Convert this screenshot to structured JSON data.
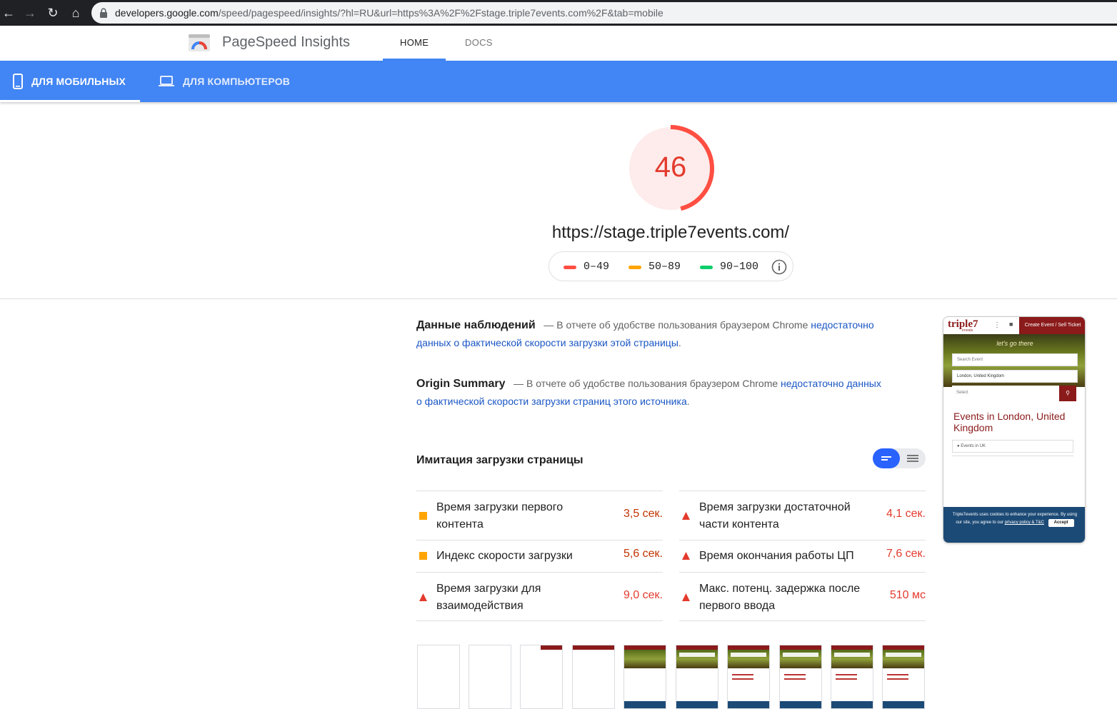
{
  "browser": {
    "url_host": "developers.google.com",
    "url_rest": "/speed/pagespeed/insights/?hl=RU&url=https%3A%2F%2Fstage.triple7events.com%2F&tab=mobile"
  },
  "header": {
    "app_title": "PageSpeed Insights",
    "nav": [
      "HOME",
      "DOCS"
    ]
  },
  "device_tabs": {
    "mobile": "ДЛЯ МОБИЛЬНЫХ",
    "desktop": "ДЛЯ КОМПЬЮТЕРОВ"
  },
  "summary": {
    "score": "46",
    "score_fraction": 0.46,
    "url": "https://stage.triple7events.com/",
    "legend": [
      "0–49",
      "50–89",
      "90–100"
    ]
  },
  "colors": {
    "fail": "#e33b2e",
    "average": "#ffa400",
    "pass": "#0cce6b",
    "brand": "#4285f4"
  },
  "field_data": {
    "title": "Данные наблюдений",
    "dash": "—",
    "text": "В отчете об удобстве пользования браузером Chrome",
    "link": "недостаточно данных о фактической скорости загрузки этой страницы",
    "tail": "."
  },
  "origin_summary": {
    "title": "Origin Summary",
    "dash": "—",
    "text": "В отчете об удобстве пользования браузером Chrome",
    "link": "недостаточно данных о фактической скорости загрузки страниц этого источника",
    "tail": "."
  },
  "lab": {
    "title": "Имитация загрузки страницы",
    "metrics": [
      {
        "name": "Время загрузки первого контента",
        "value": "3,5 сек.",
        "status": "average"
      },
      {
        "name": "Время загрузки достаточной части контента",
        "value": "4,1 сек.",
        "status": "fail"
      },
      {
        "name": "Индекс скорости загрузки",
        "value": "5,6 сек.",
        "status": "average"
      },
      {
        "name": "Время окончания работы ЦП",
        "value": "7,6 сек.",
        "status": "fail"
      },
      {
        "name": "Время загрузки для взаимодействия",
        "value": "9,0 сек.",
        "status": "fail"
      },
      {
        "name": "Макс. потенц. задержка после первого ввода",
        "value": "510 мс",
        "status": "fail"
      }
    ]
  },
  "preview": {
    "logo": "triple7",
    "logo_sub": "events",
    "cta": "Create Event / Sell Ticket",
    "hero": "let's go there",
    "search_placeholder": "Search Event",
    "location": "London, United Kingdom",
    "select": "Select",
    "heading": "Events in London, United Kingdom",
    "chip": "Events in UK",
    "cookie_text": "Triple7events uses cookies to enhance your experience. By using our site, you agree to our",
    "cookie_link": "privacy policy & T&C",
    "accept": "Accept"
  }
}
